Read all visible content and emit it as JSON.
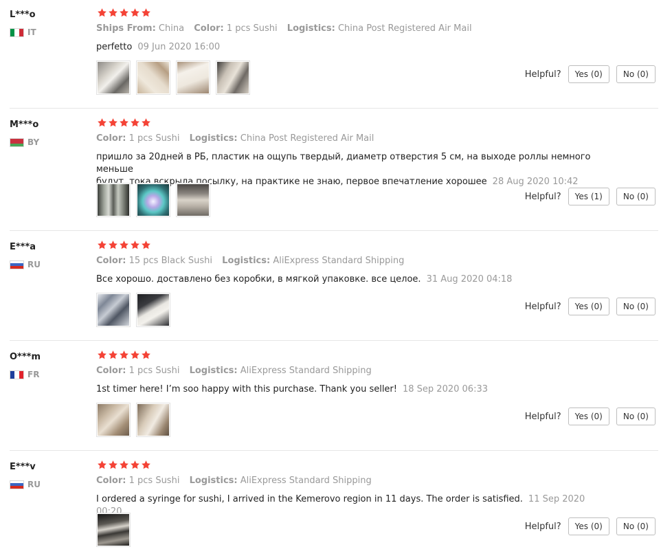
{
  "labels": {
    "ships_from": "Ships From:",
    "color": "Color:",
    "logistics": "Logistics:",
    "helpful": "Helpful?"
  },
  "colors": {
    "star": "#f44336",
    "label": "#999999"
  },
  "reviews": [
    {
      "user": "L***o",
      "country": "IT",
      "rating": 5,
      "ships_from": "China",
      "color": "1 pcs Sushi",
      "logistics": "China Post Registered Air Mail",
      "text": "perfetto",
      "date": "09 Jun 2020 16:00",
      "photo_count": 4,
      "yes": "Yes (0)",
      "no": "No (0)"
    },
    {
      "user": "M***o",
      "country": "BY",
      "rating": 5,
      "color": "1 pcs Sushi",
      "logistics": "China Post Registered Air Mail",
      "text_line1": "пришло за 20дней в РБ, пластик на ощупь твердый, диаметр отверстия 5 см, на выходе роллы немного меньше",
      "text_line2": "будут, тока вскрыла посылку, на практике не знаю, первое впечатление хорошее",
      "date": "28 Aug 2020 10:42",
      "photo_count": 3,
      "yes": "Yes (1)",
      "no": "No (0)"
    },
    {
      "user": "E***a",
      "country": "RU",
      "rating": 5,
      "color": "15 pcs Black Sushi",
      "logistics": "AliExpress Standard Shipping",
      "text": "Все хорошо. доставлено без коробки, в мягкой упаковке. все целое.",
      "date": "31 Aug 2020 04:18",
      "photo_count": 2,
      "yes": "Yes (0)",
      "no": "No (0)"
    },
    {
      "user": "O***m",
      "country": "FR",
      "rating": 5,
      "color": "1 pcs Sushi",
      "logistics": "AliExpress Standard Shipping",
      "text": "1st timer here! I’m soo happy with this purchase. Thank you seller!",
      "date": "18 Sep 2020 06:33",
      "photo_count": 2,
      "yes": "Yes (0)",
      "no": "No (0)"
    },
    {
      "user": "E***v",
      "country": "RU",
      "rating": 5,
      "color": "1 pcs Sushi",
      "logistics": "AliExpress Standard Shipping",
      "text": "I ordered a syringe for sushi, I arrived in the Kemerovo region in 11 days. The order is satisfied.",
      "date": "11 Sep 2020 00:20",
      "photo_count": 1,
      "yes": "Yes (0)",
      "no": "No (0)"
    }
  ]
}
